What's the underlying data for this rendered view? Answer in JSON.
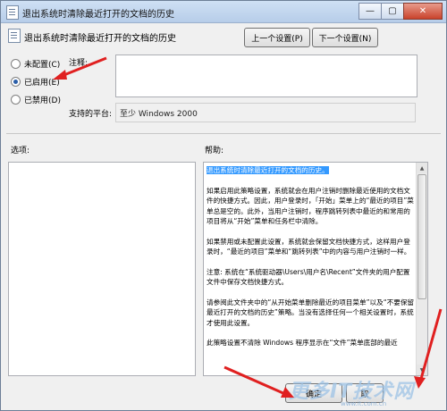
{
  "window": {
    "title": "退出系统时清除最近打开的文档的历史",
    "controls": {
      "minimize": "—",
      "maximize": "▢",
      "close": "✕"
    }
  },
  "header": {
    "title": "退出系统时清除最近打开的文档的历史",
    "prev_button": "上一个设置(P)",
    "next_button": "下一个设置(N)"
  },
  "options": {
    "not_configured": "未配置(C)",
    "enabled": "已启用(E)",
    "disabled": "已禁用(D)",
    "selected": "enabled"
  },
  "comment": {
    "label": "注释:",
    "value": ""
  },
  "platform": {
    "label": "支持的平台:",
    "value": "至少 Windows 2000"
  },
  "options_pane": {
    "label": "选项:"
  },
  "help_pane": {
    "label": "帮助:",
    "title": "退出系统时清除最近打开的文档的历史。",
    "paragraphs": [
      "如果启用此策略设置，系统就会在用户注销时删除最近使用的文档文件的快捷方式。因此，用户登录时，「开始」菜单上的“最近的项目”菜单总是空的。此外，当用户注销时，程序跳转列表中最近的和常用的项目将从“开始”菜单和任务栏中清除。",
      "如果禁用或未配置此设置，系统就会保留文档快捷方式，这样用户登录时，“最近的项目”菜单和“跳转列表”中的内容与用户注销时一样。",
      "注意: 系统在“系统驱动器\\Users\\用户名\\Recent”文件夹的用户配置文件中保存文档快捷方式。",
      "请参阅此文件夹中的“从开始菜单删除最近的项目菜单”以及“不要保留最近打开的文档的历史”策略。当没有选择任何一个相关设置时，系统才使用此设置。",
      "此策略设置不清除 Windows 程序显示在“文件”菜单底部的最近"
    ]
  },
  "footer": {
    "ok": "确定",
    "cancel": "取"
  },
  "watermark": {
    "text": "更多IT技术网",
    "sub": "www.it.com.cn"
  },
  "colors": {
    "annotation_arrow": "#e02020",
    "selection": "#3399ff",
    "title_bar": "#b7cde9"
  }
}
